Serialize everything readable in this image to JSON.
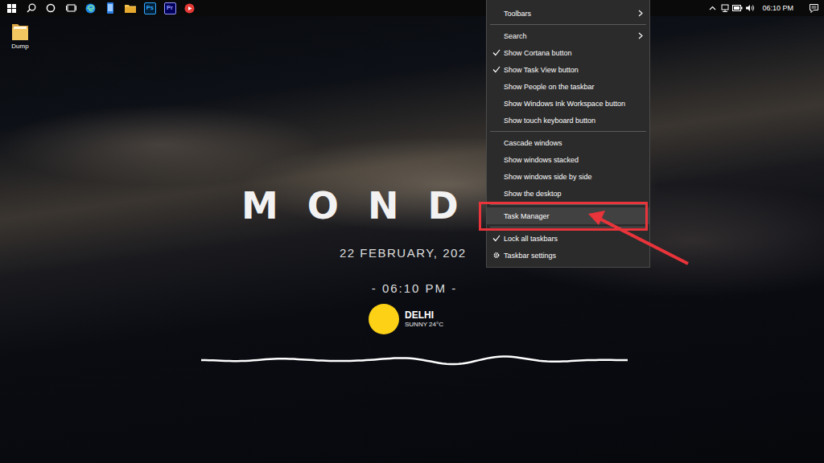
{
  "taskbar": {
    "app_labels": [
      "Ps",
      "Pr"
    ],
    "clock": "06:10 PM"
  },
  "desktop_icons": [
    {
      "label": "Dump"
    }
  ],
  "widget": {
    "day": "MOND",
    "date": "22 FEBRUARY, 202",
    "time": "- 06:10 PM -",
    "city": "DELHI",
    "weather": "SUNNY 24°C"
  },
  "menu": {
    "items": [
      {
        "kind": "submenu",
        "label": "Toolbars",
        "checked": false,
        "selected": false
      },
      {
        "kind": "separator",
        "checked": false,
        "selected": false
      },
      {
        "kind": "submenu",
        "label": "Search",
        "checked": false,
        "selected": false
      },
      {
        "kind": "item",
        "label": "Show Cortana button",
        "checked": true,
        "selected": false
      },
      {
        "kind": "item",
        "label": "Show Task View button",
        "checked": true,
        "selected": false
      },
      {
        "kind": "item",
        "label": "Show People on the taskbar",
        "checked": false,
        "selected": false
      },
      {
        "kind": "item",
        "label": "Show Windows Ink Workspace button",
        "checked": false,
        "selected": false
      },
      {
        "kind": "item",
        "label": "Show touch keyboard button",
        "checked": false,
        "selected": false
      },
      {
        "kind": "separator",
        "checked": false,
        "selected": false
      },
      {
        "kind": "item",
        "label": "Cascade windows",
        "checked": false,
        "selected": false
      },
      {
        "kind": "item",
        "label": "Show windows stacked",
        "checked": false,
        "selected": false
      },
      {
        "kind": "item",
        "label": "Show windows side by side",
        "checked": false,
        "selected": false
      },
      {
        "kind": "item",
        "label": "Show the desktop",
        "checked": false,
        "selected": false
      },
      {
        "kind": "separator",
        "checked": false,
        "selected": false
      },
      {
        "kind": "item",
        "label": "Task Manager",
        "checked": false,
        "selected": true
      },
      {
        "kind": "separator",
        "checked": false,
        "selected": false
      },
      {
        "kind": "item",
        "label": "Lock all taskbars",
        "checked": true,
        "selected": false
      },
      {
        "kind": "setting",
        "label": "Taskbar settings",
        "checked": false,
        "selected": false
      }
    ]
  }
}
